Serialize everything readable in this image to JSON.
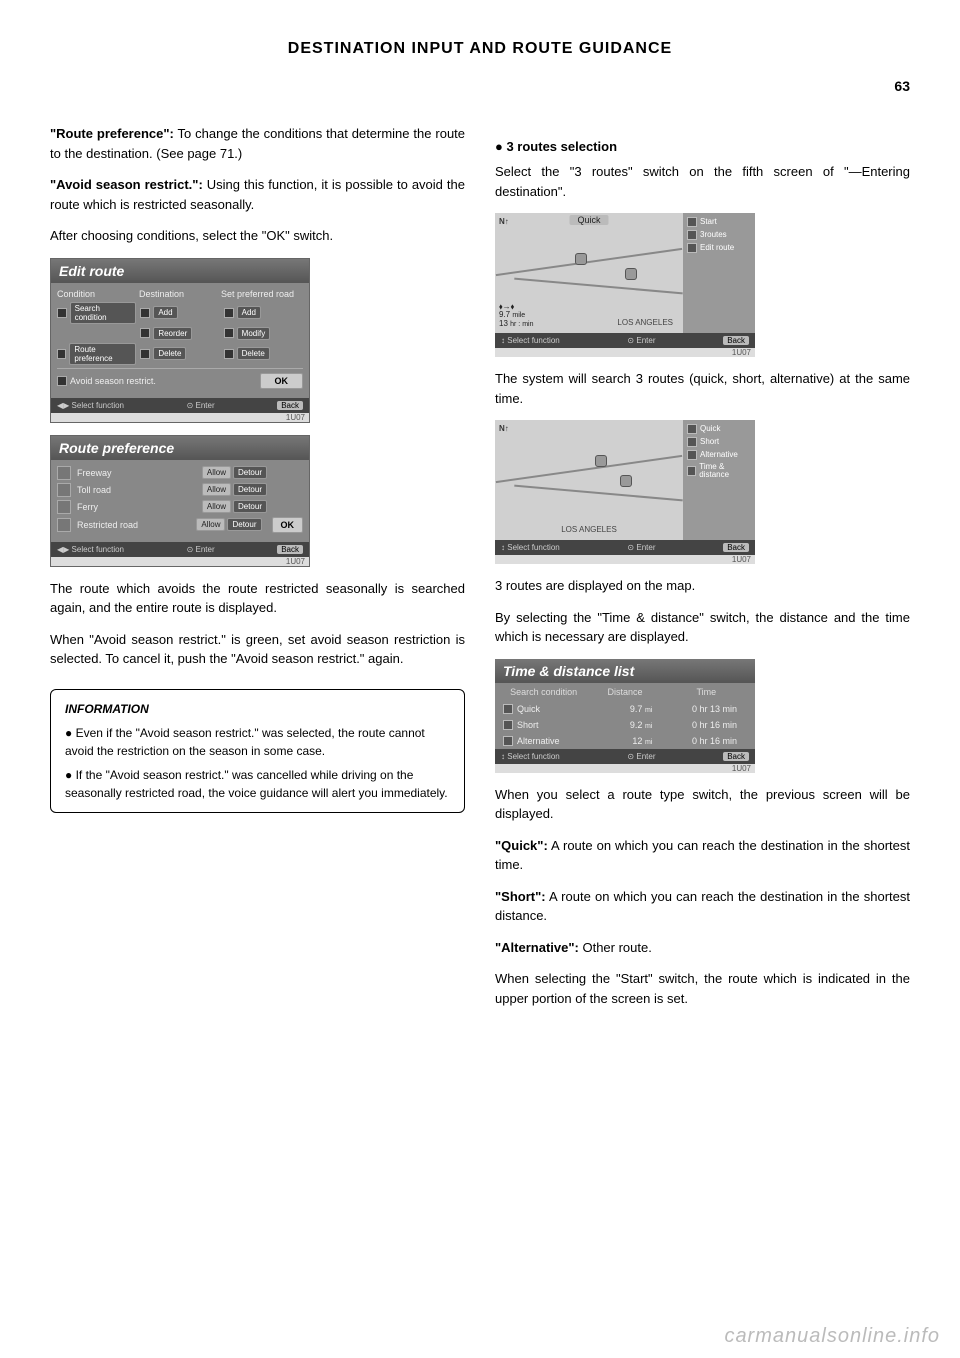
{
  "header": {
    "title": "DESTINATION INPUT AND ROUTE GUIDANCE",
    "page": "63"
  },
  "left": {
    "p1_bold": "\"Route preference\":",
    "p1_rest": " To change the conditions that determine the route to the destination. (See page 71.)",
    "p2_bold": "\"Avoid season restrict.\":",
    "p2_rest": " Using this function, it is possible to avoid the route which is restricted seasonally.",
    "p3": "After choosing conditions, select the \"OK\" switch.",
    "editRoute": {
      "title": "Edit route",
      "subheaders": {
        "condition": "Condition",
        "destination": "Destination",
        "preferred": "Set preferred road"
      },
      "btns": {
        "searchCond": "Search condition",
        "routePref": "Route preference",
        "add1": "Add",
        "reorder": "Reorder",
        "delete1": "Delete",
        "add2": "Add",
        "modify": "Modify",
        "delete2": "Delete",
        "avoid": "Avoid season restrict.",
        "ok": "OK"
      }
    },
    "routePref": {
      "title": "Route preference",
      "rows": [
        {
          "icon": "freeway-icon",
          "label": "Freeway",
          "allow": "Allow",
          "detour": "Detour"
        },
        {
          "icon": "toll-icon",
          "label": "Toll road",
          "allow": "Allow",
          "detour": "Detour"
        },
        {
          "icon": "ferry-icon",
          "label": "Ferry",
          "allow": "Allow",
          "detour": "Detour"
        },
        {
          "icon": "restricted-icon",
          "label": "Restricted road",
          "allow": "Allow",
          "detour": "Detour"
        }
      ],
      "ok": "OK"
    },
    "p4": "The route which avoids the route restricted seasonally is searched again, and the entire route is displayed.",
    "p5": "When \"Avoid season restrict.\" is green, set avoid season restriction is selected. To cancel it, push the \"Avoid season restrict.\" again.",
    "info": {
      "title": "INFORMATION",
      "items": [
        "Even if the \"Avoid season restrict.\" was selected, the route cannot avoid the restriction on the season in some case.",
        "If the \"Avoid season restrict.\" was cancelled while driving on the seasonally restricted road, the voice guidance will alert you immediately."
      ]
    }
  },
  "right": {
    "bullet": "3 routes selection",
    "p1": "Select the \"3 routes\" switch on the fifth screen of \"—Entering destination\".",
    "map1": {
      "topLabel": "Quick",
      "city": "LOS ANGELES",
      "compass": "N",
      "info1": "9.7",
      "info1u": "mile",
      "info2": "13",
      "info2u": "hr : min",
      "side": [
        {
          "name": "start",
          "label": "Start"
        },
        {
          "name": "3routes",
          "label": "3routes"
        },
        {
          "name": "editroute",
          "label": "Edit route"
        }
      ]
    },
    "p2": "The system will search 3 routes (quick, short, alternative) at the same time.",
    "map2": {
      "compass": "N",
      "city": "LOS ANGELES",
      "side": [
        {
          "name": "quick",
          "label": "Quick"
        },
        {
          "name": "short",
          "label": "Short"
        },
        {
          "name": "alternative",
          "label": "Alternative"
        },
        {
          "name": "timedist",
          "label": "Time & distance"
        }
      ]
    },
    "p3": "3 routes are displayed on the map.",
    "p4": "By selecting the \"Time & distance\" switch, the distance and the time which is necessary are displayed.",
    "tdList": {
      "title": "Time & distance list",
      "headers": {
        "search": "Search condition",
        "distance": "Distance",
        "time": "Time"
      },
      "rows": [
        {
          "name": "Quick",
          "dist": "9.7",
          "distU": "mi",
          "time": "0 hr 13 min"
        },
        {
          "name": "Short",
          "dist": "9.2",
          "distU": "mi",
          "time": "0 hr 16 min"
        },
        {
          "name": "Alternative",
          "dist": "12",
          "distU": "mi",
          "time": "0 hr 16 min"
        }
      ]
    },
    "p5": "When you select a route type switch, the previous screen will be displayed.",
    "p6_bold": "\"Quick\":",
    "p6_rest": " A route on which you can reach the destination in the shortest time.",
    "p7_bold": "\"Short\":",
    "p7_rest": " A route on which you can reach the destination in the shortest distance.",
    "p8_bold": "\"Alternative\":",
    "p8_rest": " Other route.",
    "p9": "When selecting the \"Start\" switch, the route which is indicated in the upper portion of the screen is set."
  },
  "footer": {
    "selectFn": "Select function",
    "enter": "Enter",
    "back": "Back",
    "wm": "1U07"
  },
  "watermark": "carmanualsonline.info"
}
